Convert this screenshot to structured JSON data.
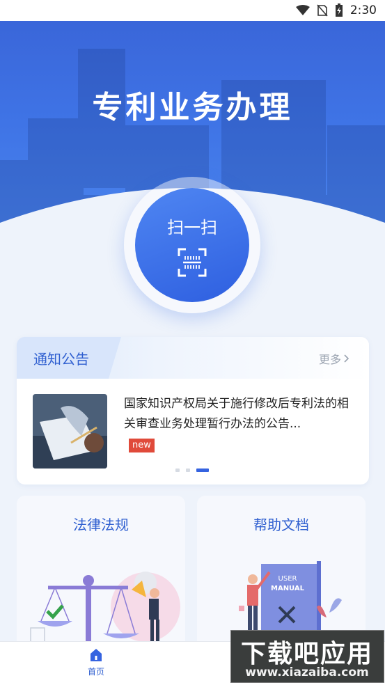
{
  "status_bar": {
    "time": "2:30"
  },
  "hero": {
    "title": "专利业务办理"
  },
  "scan": {
    "label": "扫一扫"
  },
  "notice": {
    "title": "通知公告",
    "more": "更多",
    "text": "国家知识产权局关于施行修改后专利法的相关审查业务处理暂行办法的公告...",
    "badge": "new",
    "dots_active": 3,
    "dots_total": 3
  },
  "tiles": [
    {
      "title": "法律法规",
      "icon": "scales-illustration"
    },
    {
      "title": "帮助文档",
      "icon": "user-manual-illustration",
      "art_text_1": "USER",
      "art_text_2": "MANUAL"
    }
  ],
  "bottom_nav": {
    "home_label": "首页"
  },
  "watermark": {
    "text": "下载吧应用",
    "url": "www.xiazaiba.com"
  },
  "colors": {
    "primary": "#3563e0",
    "badge": "#e04a3a",
    "page_bg": "#eef3fb"
  }
}
